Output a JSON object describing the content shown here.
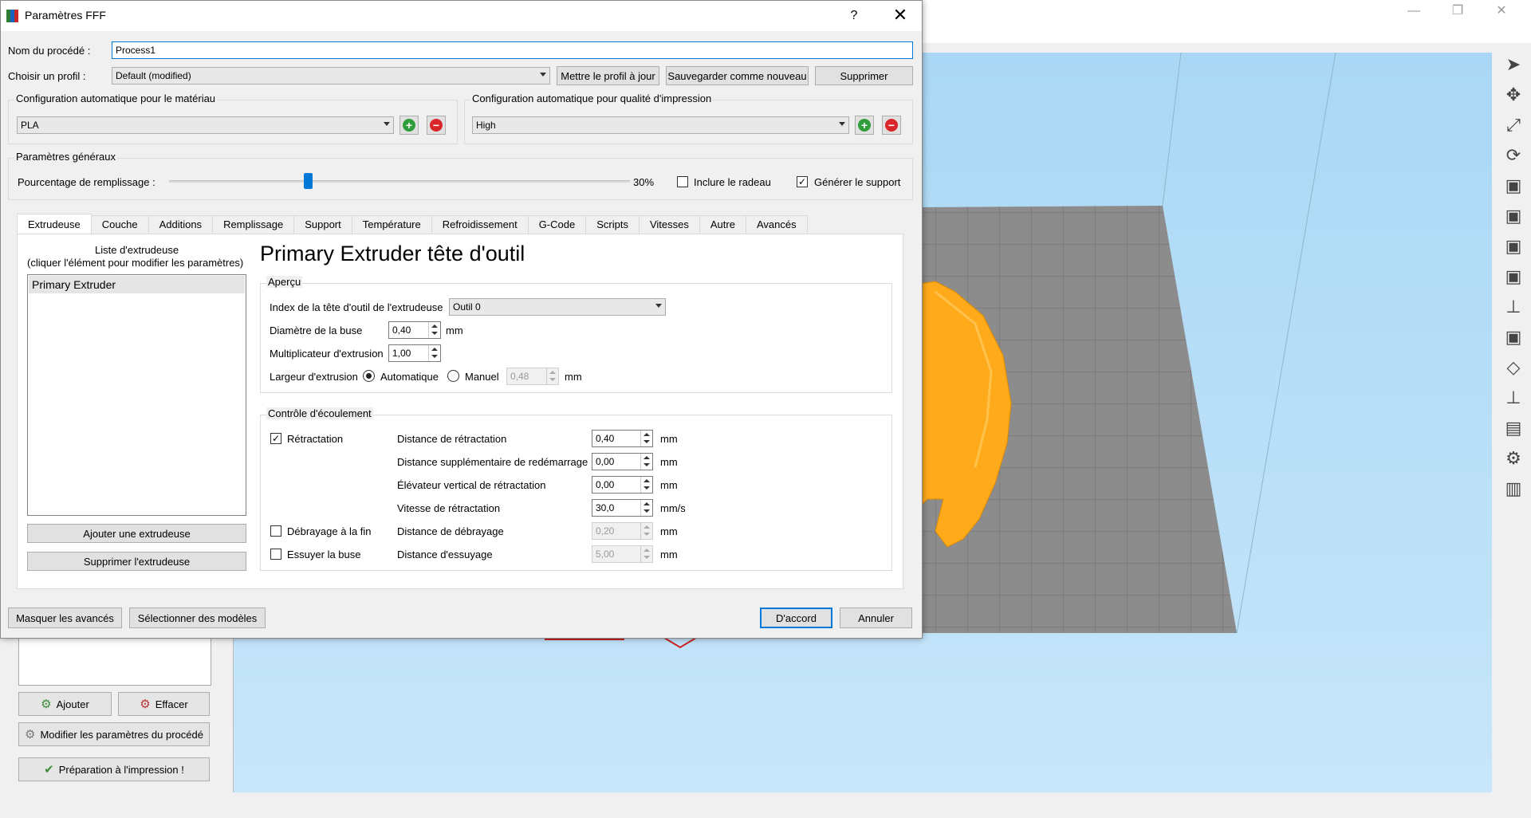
{
  "dialog": {
    "title": "Paramètres FFF",
    "help": "?",
    "close": "✕",
    "process_label": "Nom du procédé :",
    "process_value": "Process1",
    "profile_label": "Choisir un profil :",
    "profile_value": "Default (modified)",
    "update_profile": "Mettre le profil à jour",
    "save_as_new": "Sauvegarder comme nouveau",
    "delete": "Supprimer",
    "material_group": "Configuration automatique pour le matériau",
    "material_value": "PLA",
    "quality_group": "Configuration automatique pour qualité d'impression",
    "quality_value": "High",
    "general_group": "Paramètres généraux",
    "infill_label": "Pourcentage de remplissage :",
    "infill_percent": "30%",
    "infill_fraction": 0.3,
    "raft_label": "Inclure le radeau",
    "raft_checked": false,
    "support_label": "Générer le support",
    "support_checked": true,
    "tabs": [
      "Extrudeuse",
      "Couche",
      "Additions",
      "Remplissage",
      "Support",
      "Température",
      "Refroidissement",
      "G-Code",
      "Scripts",
      "Vitesses",
      "Autre",
      "Avancés"
    ],
    "active_tab": 0,
    "extruder_list_title_1": "Liste d'extrudeuse",
    "extruder_list_title_2": "(cliquer l'élément pour modifier les paramètres)",
    "extruder_items": [
      "Primary Extruder"
    ],
    "add_extruder": "Ajouter une extrudeuse",
    "remove_extruder": "Supprimer l'extrudeuse",
    "heading": "Primary Extruder tête d'outil",
    "overview_group": "Aperçu",
    "tool_index_label": "Index de la tête d'outil de l'extrudeuse",
    "tool_index_value": "Outil 0",
    "nozzle_label": "Diamètre de la buse",
    "nozzle_value": "0,40",
    "mult_label": "Multiplicateur d'extrusion",
    "mult_value": "1,00",
    "width_label": "Largeur d'extrusion",
    "auto_label": "Automatique",
    "manual_label": "Manuel",
    "width_value": "0,48",
    "unit_mm": "mm",
    "unit_mms": "mm/s",
    "flow_group": "Contrôle d'écoulement",
    "retraction_label": "Rétractation",
    "retraction_checked": true,
    "coast_label": "Débrayage à la fin",
    "coast_checked": false,
    "wipe_label": "Essuyer la buse",
    "wipe_checked": false,
    "rows": [
      {
        "label": "Distance de rétractation",
        "value": "0,40",
        "unit": "mm",
        "enabled": true
      },
      {
        "label": "Distance supplémentaire de redémarrage",
        "value": "0,00",
        "unit": "mm",
        "enabled": true
      },
      {
        "label": "Élévateur vertical de rétractation",
        "value": "0,00",
        "unit": "mm",
        "enabled": true
      },
      {
        "label": "Vitesse de rétractation",
        "value": "30,0",
        "unit": "mm/s",
        "enabled": true
      },
      {
        "label": "Distance de débrayage",
        "value": "0,20",
        "unit": "mm",
        "enabled": false
      },
      {
        "label": "Distance d'essuyage",
        "value": "5,00",
        "unit": "mm",
        "enabled": false
      }
    ],
    "hide_advanced": "Masquer les avancés",
    "select_models": "Sélectionner des modèles",
    "ok": "D'accord",
    "cancel": "Annuler"
  },
  "left_panel": {
    "add": "Ajouter",
    "clear": "Effacer",
    "edit_process": "Modifier les paramètres du procédé",
    "prepare": "Préparation à l'impression !"
  },
  "window_controls": {
    "minimize": "—",
    "maximize": "❐",
    "close": "✕"
  },
  "colors": {
    "accent": "#0078d7",
    "add_green": "#2e9d3a",
    "remove_red": "#d9262b",
    "model_orange": "#ffaa1a",
    "bed_gray": "#8c8c8c"
  }
}
